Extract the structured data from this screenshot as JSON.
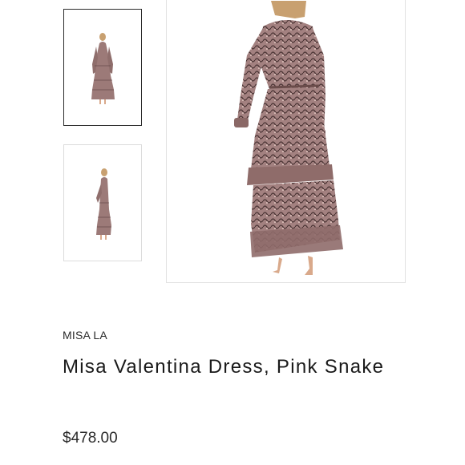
{
  "gallery": {
    "thumbnails": [
      {
        "view": "back",
        "selected": true
      },
      {
        "view": "side",
        "selected": false
      }
    ],
    "main_image": {
      "view": "back"
    }
  },
  "product": {
    "brand": "MISA LA",
    "title": "Misa Valentina Dress, Pink Snake",
    "price": "$478.00"
  },
  "colors": {
    "dress": "#9c7a78",
    "dress_pattern": "#4a3434",
    "skin": "#d9a98b",
    "hair": "#c8a070",
    "border_active": "#2b2b2b",
    "border": "#dcdcdc"
  }
}
